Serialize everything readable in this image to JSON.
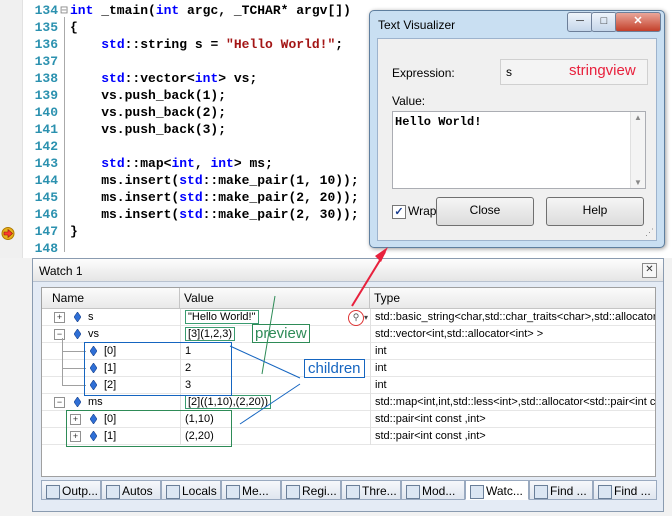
{
  "editor": {
    "lines": [
      {
        "num": "134",
        "fold": "⊟",
        "code": "int _tmain(int argc, _TCHAR* argv[])"
      },
      {
        "num": "135",
        "fold": "",
        "code": "{"
      },
      {
        "num": "136",
        "fold": "",
        "code": "    std::string s = \"Hello World!\";"
      },
      {
        "num": "137",
        "fold": "",
        "code": ""
      },
      {
        "num": "138",
        "fold": "",
        "code": "    std::vector<int> vs;"
      },
      {
        "num": "139",
        "fold": "",
        "code": "    vs.push_back(1);"
      },
      {
        "num": "140",
        "fold": "",
        "code": "    vs.push_back(2);"
      },
      {
        "num": "141",
        "fold": "",
        "code": "    vs.push_back(3);"
      },
      {
        "num": "142",
        "fold": "",
        "code": ""
      },
      {
        "num": "143",
        "fold": "",
        "code": "    std::map<int, int> ms;"
      },
      {
        "num": "144",
        "fold": "",
        "code": "    ms.insert(std::make_pair(1, 10));"
      },
      {
        "num": "145",
        "fold": "",
        "code": "    ms.insert(std::make_pair(2, 20));"
      },
      {
        "num": "146",
        "fold": "",
        "code": "    ms.insert(std::make_pair(2, 30));"
      },
      {
        "num": "147",
        "fold": "",
        "code": "}"
      },
      {
        "num": "148",
        "fold": "",
        "code": ""
      }
    ]
  },
  "visualizer": {
    "title": "Text Visualizer",
    "expression_label": "Expression:",
    "expression_value": "s",
    "expression_annotation": "stringview",
    "value_label": "Value:",
    "value_text": "Hello World!",
    "wrap_label": "Wrap",
    "close_label": "Close",
    "help_label": "Help",
    "min_glyph": "─",
    "max_glyph": "□",
    "close_glyph": "✕"
  },
  "watch": {
    "title": "Watch 1",
    "close_glyph": "✕",
    "columns": {
      "name": "Name",
      "value": "Value",
      "type": "Type"
    },
    "rows": [
      {
        "name": "s",
        "value": "\"Hello World!\"",
        "type": "std::basic_string<char,std::char_traits<char>,std::allocator<char> >"
      },
      {
        "name": "vs",
        "value": "[3](1,2,3)",
        "type": "std::vector<int,std::allocator<int> >"
      },
      {
        "name": "[0]",
        "value": "1",
        "type": "int"
      },
      {
        "name": "[1]",
        "value": "2",
        "type": "int"
      },
      {
        "name": "[2]",
        "value": "3",
        "type": "int"
      },
      {
        "name": "ms",
        "value": "[2]((1,10),(2,20))",
        "type": "std::map<int,int,std::less<int>,std::allocator<std::pair<int const ,int> > >"
      },
      {
        "name": "[0]",
        "value": "(1,10)",
        "type": "std::pair<int const ,int>"
      },
      {
        "name": "[1]",
        "value": "(2,20)",
        "type": "std::pair<int const ,int>"
      }
    ],
    "annotations": {
      "preview": "preview",
      "children": "children"
    },
    "tabs": [
      "Outp...",
      "Autos",
      "Locals",
      "Me...",
      "Regi...",
      "Thre...",
      "Mod...",
      "Watc...",
      "Find ...",
      "Find ..."
    ],
    "active_tab": "Watc..."
  },
  "colors": {
    "keyword": "#0000ff",
    "string": "#a31515",
    "line_number": "#2b91af",
    "annotation_red": "#e8213d",
    "annotation_green": "#2e8b57",
    "annotation_blue": "#1565c0"
  }
}
